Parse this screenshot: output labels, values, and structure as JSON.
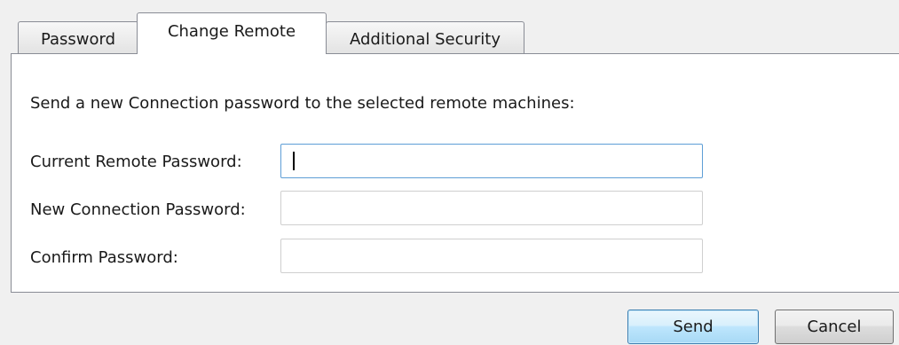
{
  "tabs": [
    {
      "label": "Password",
      "active": false
    },
    {
      "label": "Change Remote",
      "active": true
    },
    {
      "label": "Additional Security",
      "active": false
    }
  ],
  "panel": {
    "instruction": "Send a new Connection password to the selected remote machines:",
    "fields": {
      "current_label": "Current Remote Password:",
      "current_value": "",
      "new_label": "New Connection Password:",
      "new_value": "",
      "confirm_label": "Confirm Password:",
      "confirm_value": ""
    }
  },
  "buttons": {
    "send_label": "Send",
    "cancel_label": "Cancel"
  },
  "colors": {
    "tab_border": "#898c95",
    "focus_border": "#5e9ed6",
    "default_button_border": "#3c7fb1"
  }
}
